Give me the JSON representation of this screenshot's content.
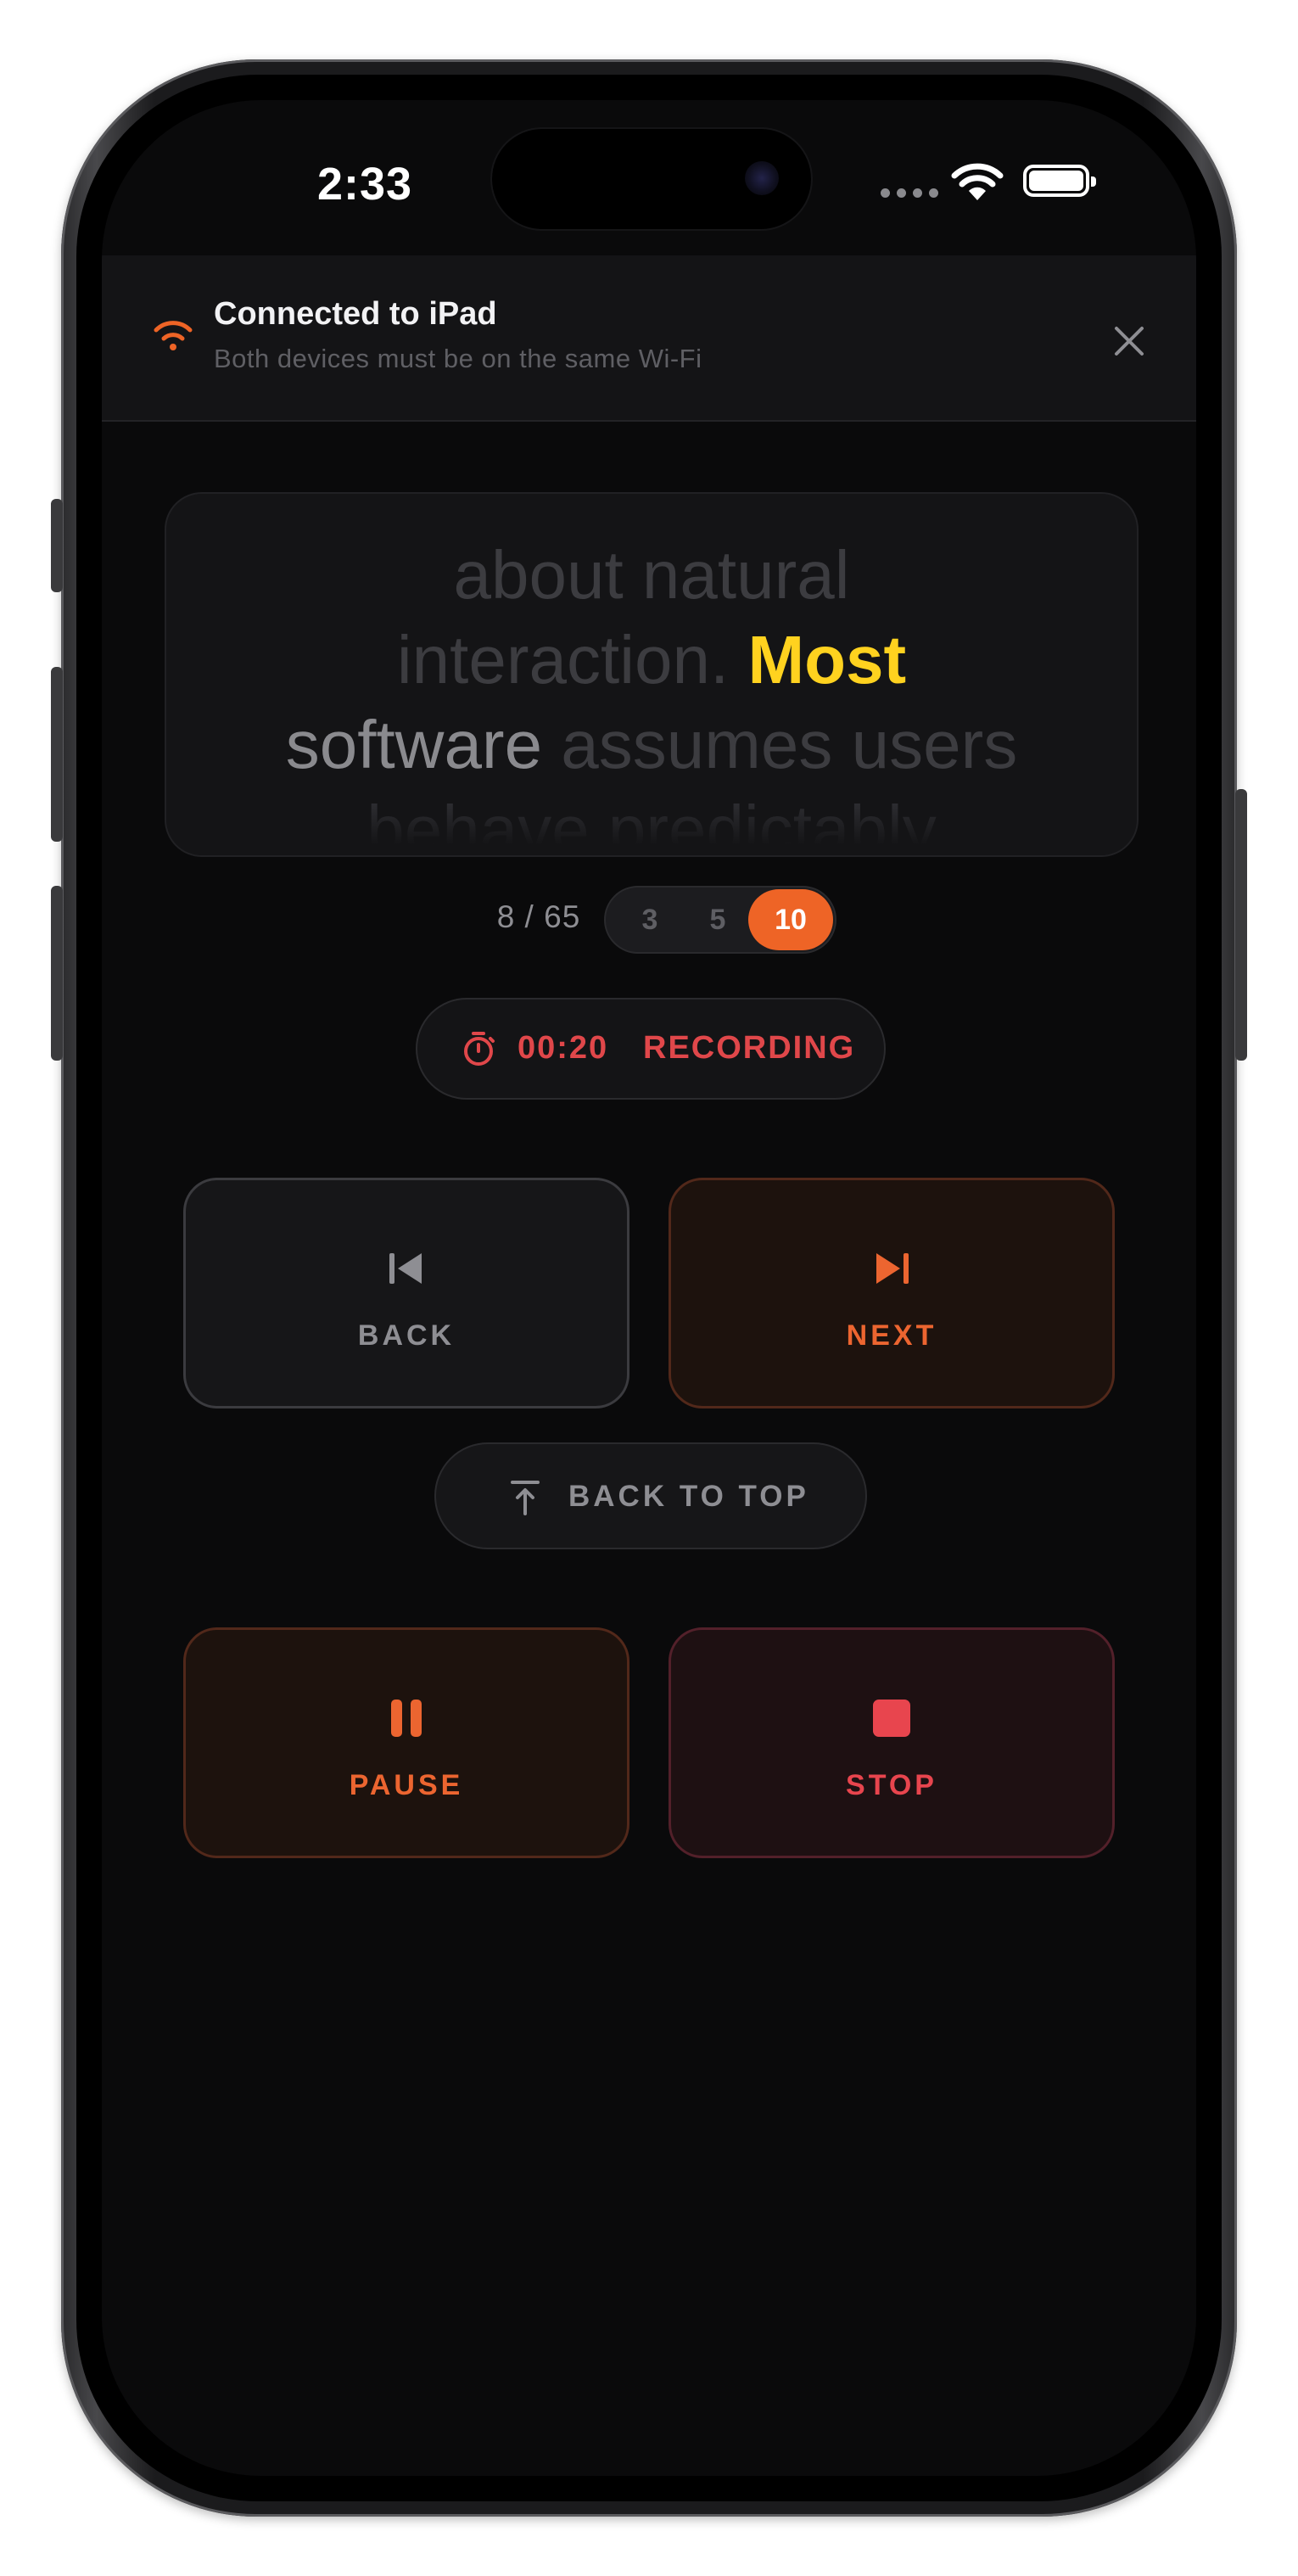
{
  "status_bar": {
    "time": "2:33"
  },
  "banner": {
    "title": "Connected to iPad",
    "subtitle": "Both devices must be on the same Wi-Fi"
  },
  "prompter": {
    "line1": "about natural",
    "line2_before": "interaction.",
    "current_word": "Most",
    "line3_read": "software",
    "line3_next": "assumes users",
    "line4": "behave predictably"
  },
  "progress": {
    "count": "8 / 65",
    "speed_options": [
      "3",
      "5",
      "10"
    ],
    "selected_speed": "10"
  },
  "recording": {
    "time": "00:20",
    "label": "RECORDING"
  },
  "controls": {
    "back_label": "BACK",
    "next_label": "NEXT",
    "top_label": "BACK TO TOP",
    "pause_label": "PAUSE",
    "stop_label": "STOP"
  },
  "colors": {
    "accent": "#ee6426",
    "highlight": "#ffd21f",
    "record": "#e0474a"
  }
}
